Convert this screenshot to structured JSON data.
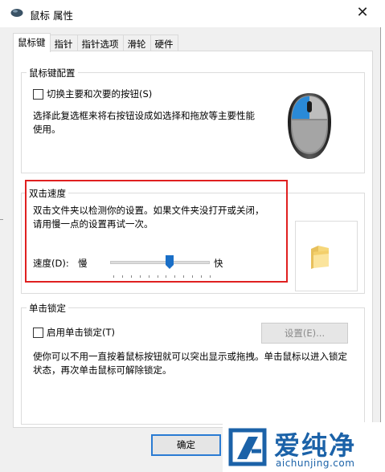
{
  "window": {
    "title": "鼠标 属性",
    "close_glyph": "✕"
  },
  "tabs": [
    {
      "label": "鼠标键",
      "active": true
    },
    {
      "label": "指针",
      "active": false
    },
    {
      "label": "指针选项",
      "active": false
    },
    {
      "label": "滑轮",
      "active": false
    },
    {
      "label": "硬件",
      "active": false
    }
  ],
  "button_config": {
    "group_title": "鼠标键配置",
    "switch_checkbox_label": "切换主要和次要的按钮(S)",
    "switch_checked": false,
    "description": "选择此复选框来将右按钮设成如选择和拖放等主要性能使用。"
  },
  "double_click": {
    "group_title": "双击速度",
    "description": "双击文件夹以检测你的设置。如果文件夹没打开或关闭，请用慢一点的设置再试一次。",
    "speed_label": "速度(D):",
    "slow_label": "慢",
    "fast_label": "快",
    "speed_fraction": 0.6
  },
  "click_lock": {
    "group_title": "单击锁定",
    "enable_checkbox_label": "启用单击锁定(T)",
    "enable_checked": false,
    "settings_button": "设置(E)...",
    "description": "使你可以不用一直按着鼠标按钮就可以突出显示或拖拽。单击鼠标以进入锁定状态，再次单击鼠标可解除锁定。"
  },
  "footer": {
    "ok_button": "确定"
  },
  "watermark": {
    "name": "爱纯净",
    "url": "aichunjing.com"
  },
  "colors": {
    "highlight_border": "#e02020",
    "ok_button_border": "#2a7bd3",
    "watermark_blue": "#1b62a8",
    "mouse_accent": "#2a8ad8"
  }
}
